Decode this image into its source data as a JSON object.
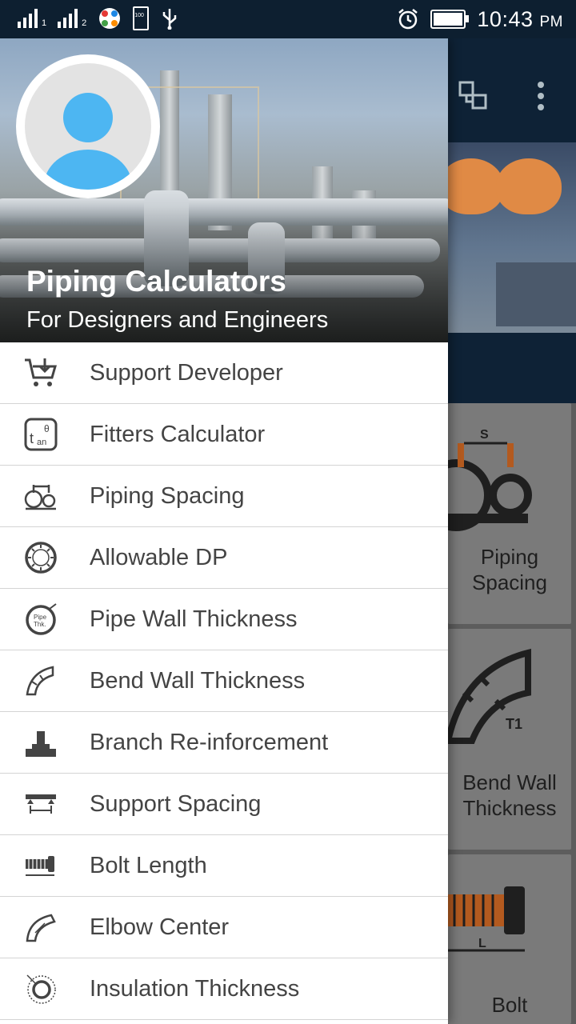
{
  "status_bar": {
    "time": "10:43",
    "ampm": "PM",
    "sim1": "1",
    "sim2": "2",
    "battery_badge": "100"
  },
  "drawer": {
    "title": "Piping Calculators",
    "subtitle": "For Designers and Engineers",
    "items": [
      {
        "label": "Support Developer",
        "icon": "cart-download-icon"
      },
      {
        "label": "Fitters Calculator",
        "icon": "tan-theta-icon"
      },
      {
        "label": "Piping Spacing",
        "icon": "pipe-spacing-icon"
      },
      {
        "label": "Allowable DP",
        "icon": "gauge-icon"
      },
      {
        "label": "Pipe Wall Thickness",
        "icon": "pipe-thickness-icon"
      },
      {
        "label": "Bend Wall Thickness",
        "icon": "bend-icon"
      },
      {
        "label": "Branch Re-inforcement",
        "icon": "branch-icon"
      },
      {
        "label": "Support Spacing",
        "icon": "support-spacing-icon"
      },
      {
        "label": "Bolt Length",
        "icon": "bolt-icon"
      },
      {
        "label": "Elbow Center",
        "icon": "elbow-icon"
      },
      {
        "label": "Insulation Thickness",
        "icon": "insulation-icon"
      }
    ]
  },
  "background": {
    "cards": [
      {
        "line1": "Piping",
        "line2": "Spacing"
      },
      {
        "line1": "Bend Wall",
        "line2": "Thickness"
      },
      {
        "line1": "Bolt",
        "line2": ""
      }
    ],
    "card_letter_s": "S",
    "card_letter_t1": "T1",
    "card_letter_l": "L"
  }
}
